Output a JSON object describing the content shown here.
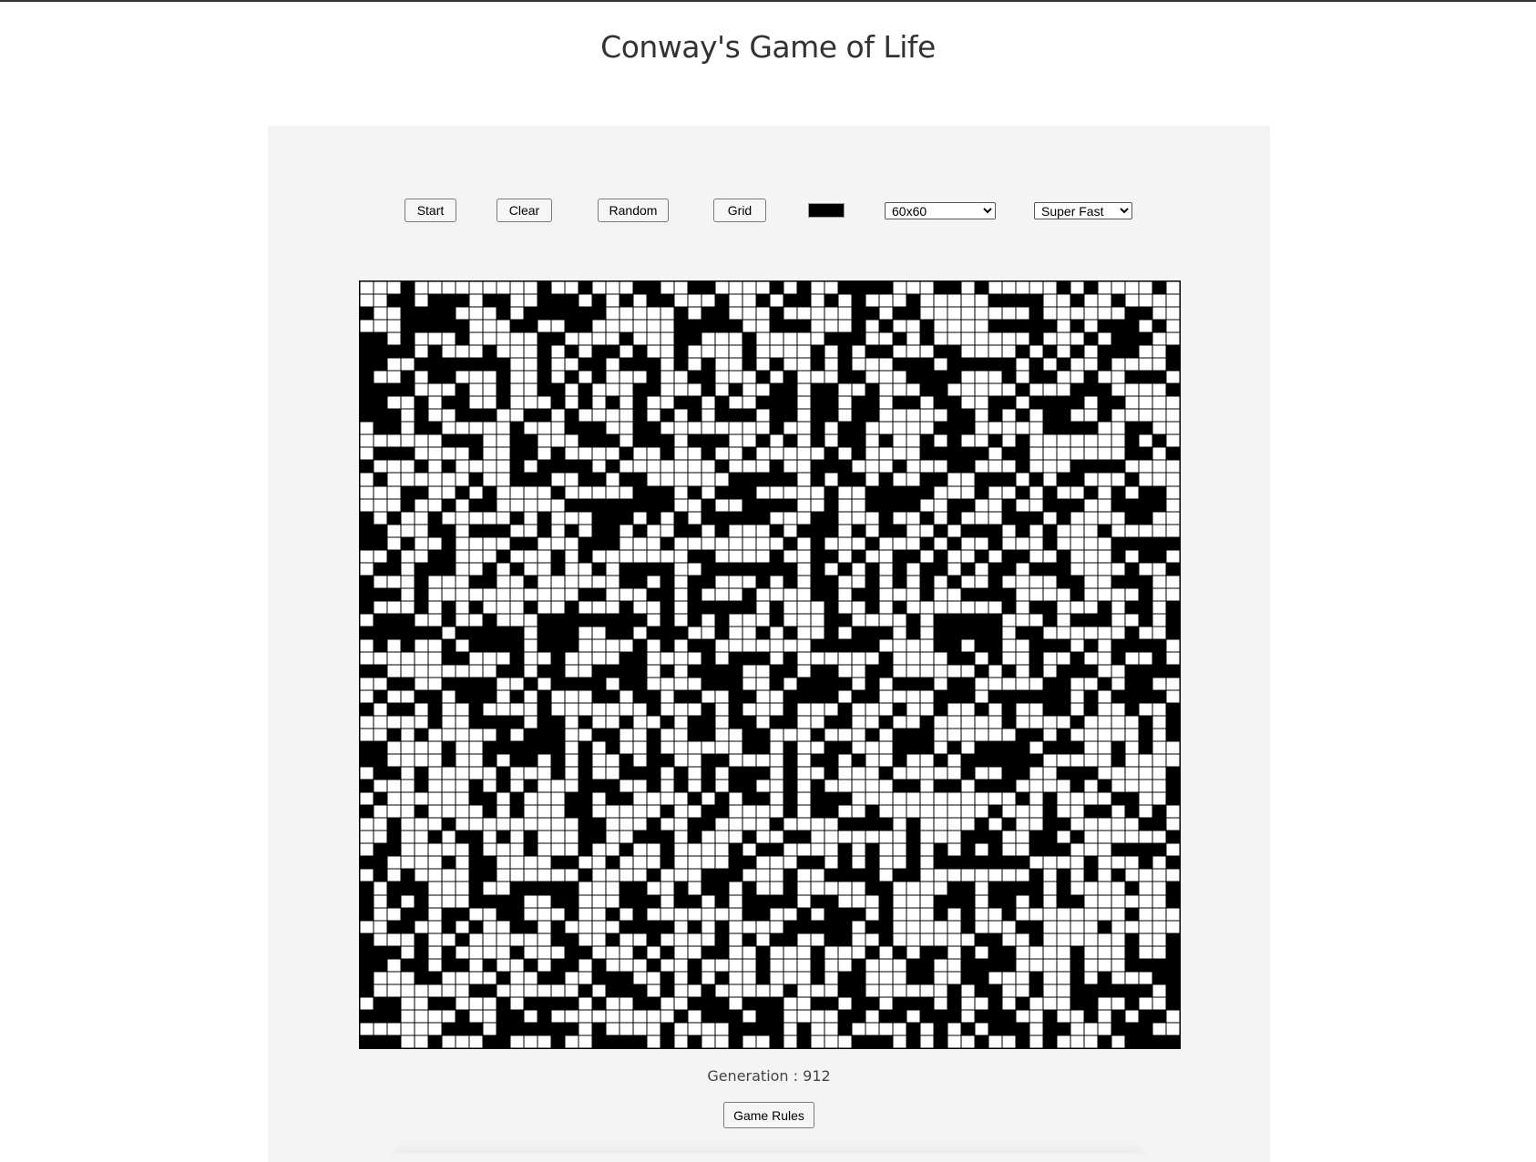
{
  "page": {
    "title": "Conway's Game of Life"
  },
  "toolbar": {
    "start_label": "Start",
    "clear_label": "Clear",
    "random_label": "Random",
    "grid_label": "Grid",
    "cell_color": "#000000",
    "size_select": {
      "selected": "60x60"
    },
    "speed_select": {
      "selected": "Super Fast"
    }
  },
  "board": {
    "rows": 60,
    "cols": 60,
    "alive_color": "#000000",
    "dead_color": "#ffffff"
  },
  "status": {
    "generation_text": "Generation : 912"
  },
  "footer": {
    "rules_label": "Game Rules"
  }
}
